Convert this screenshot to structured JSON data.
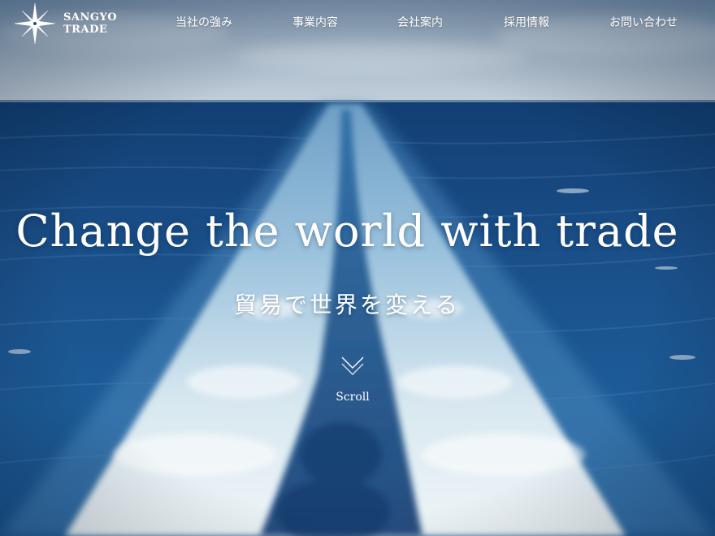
{
  "brand": {
    "line1": "SANGYO",
    "line2": "TRADE"
  },
  "nav": {
    "items": [
      {
        "label": "当社の強み"
      },
      {
        "label": "事業内容"
      },
      {
        "label": "会社案内"
      },
      {
        "label": "採用情報"
      },
      {
        "label": "お問い合わせ"
      }
    ]
  },
  "hero": {
    "headline": "Change the world with trade",
    "subheadline": "貿易で世界を変える",
    "scroll_label": "Scroll"
  },
  "colors": {
    "sky": "#a9bccd",
    "ocean_deep": "#0f3d78",
    "ocean_mid": "#2a6aa8",
    "foam": "#e8f1f6",
    "text": "#ffffff"
  },
  "icons": {
    "logo": "compass-star-icon",
    "scroll": "chevron-down-icon"
  }
}
